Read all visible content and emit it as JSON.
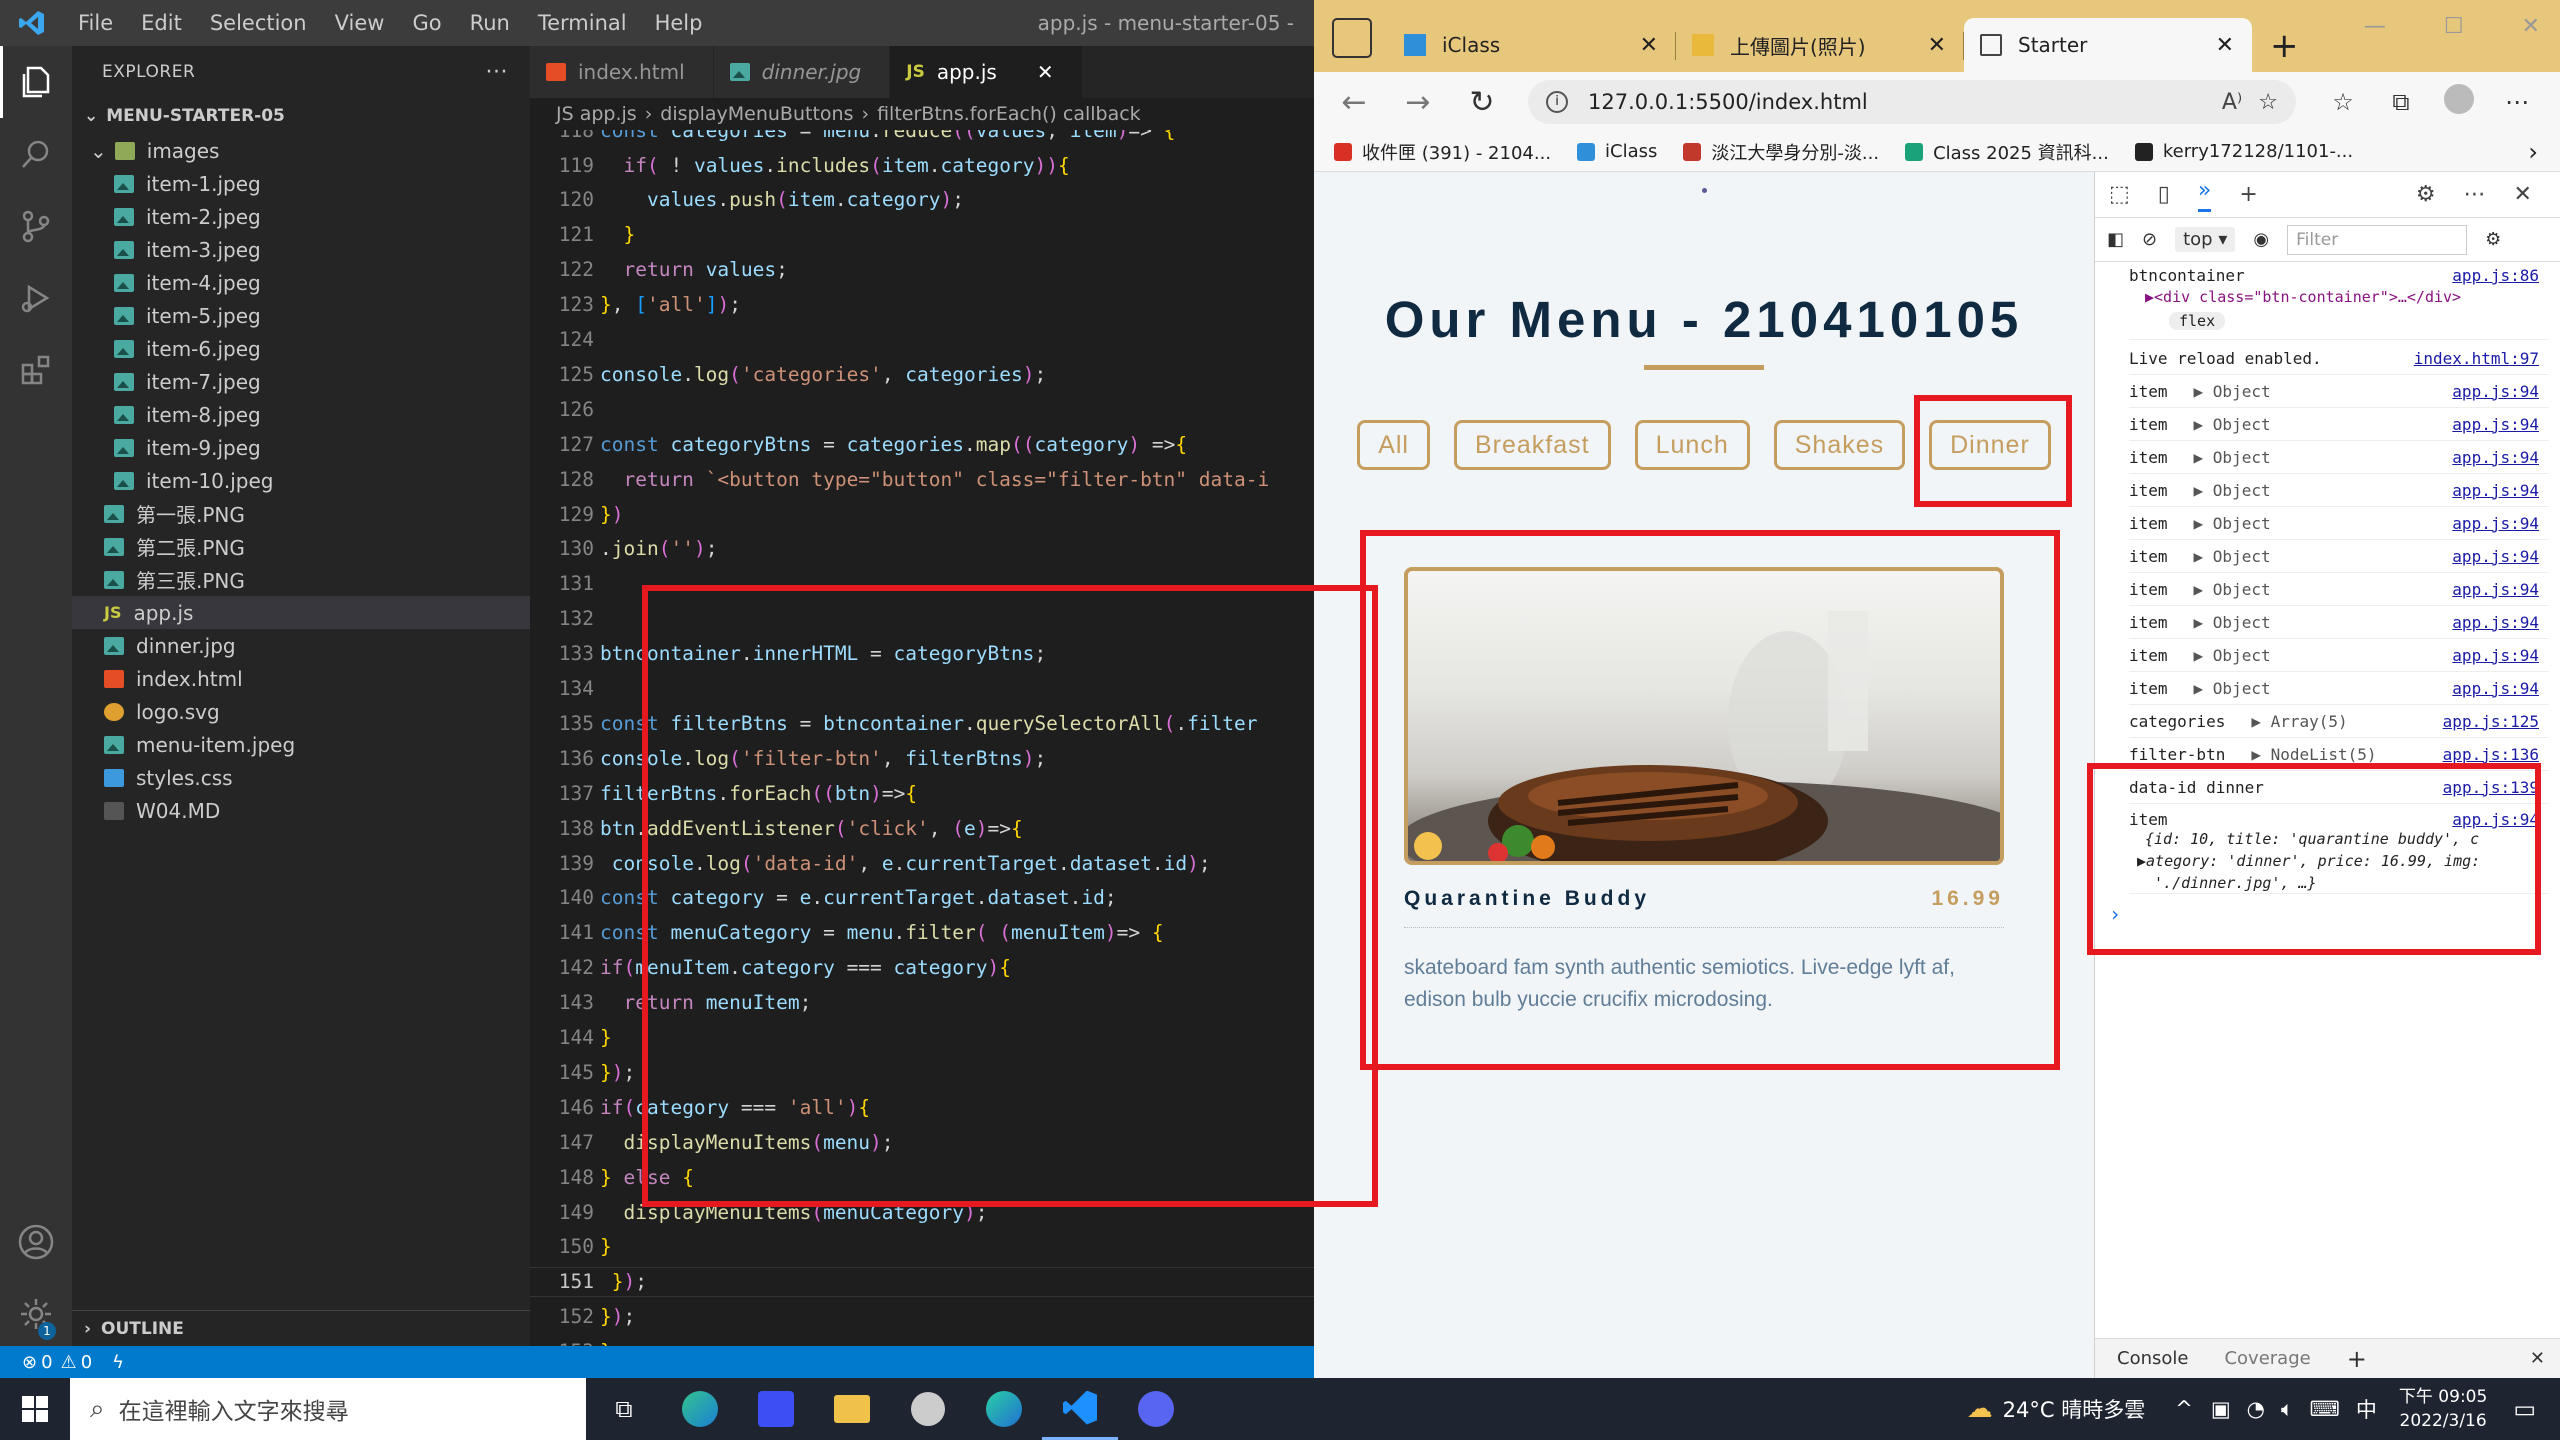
{
  "vscode": {
    "menu": [
      "File",
      "Edit",
      "Selection",
      "View",
      "Go",
      "Run",
      "Terminal",
      "Help"
    ],
    "window_title": "app.js - menu-starter-05 -",
    "explorer_label": "EXPLORER",
    "project": "MENU-STARTER-05",
    "tree": [
      {
        "name": "images",
        "type": "folder",
        "depth": 1
      },
      {
        "name": "item-1.jpeg",
        "type": "img",
        "depth": 2
      },
      {
        "name": "item-2.jpeg",
        "type": "img",
        "depth": 2
      },
      {
        "name": "item-3.jpeg",
        "type": "img",
        "depth": 2
      },
      {
        "name": "item-4.jpeg",
        "type": "img",
        "depth": 2
      },
      {
        "name": "item-5.jpeg",
        "type": "img",
        "depth": 2
      },
      {
        "name": "item-6.jpeg",
        "type": "img",
        "depth": 2
      },
      {
        "name": "item-7.jpeg",
        "type": "img",
        "depth": 2
      },
      {
        "name": "item-8.jpeg",
        "type": "img",
        "depth": 2
      },
      {
        "name": "item-9.jpeg",
        "type": "img",
        "depth": 2
      },
      {
        "name": "item-10.jpeg",
        "type": "img",
        "depth": 2
      },
      {
        "name": "第一張.PNG",
        "type": "img",
        "depth": 1
      },
      {
        "name": "第二張.PNG",
        "type": "img",
        "depth": 1
      },
      {
        "name": "第三張.PNG",
        "type": "img",
        "depth": 1
      },
      {
        "name": "app.js",
        "type": "js",
        "depth": 1,
        "selected": true
      },
      {
        "name": "dinner.jpg",
        "type": "img",
        "depth": 1
      },
      {
        "name": "index.html",
        "type": "html",
        "depth": 1
      },
      {
        "name": "logo.svg",
        "type": "svg",
        "depth": 1
      },
      {
        "name": "menu-item.jpeg",
        "type": "img",
        "depth": 1
      },
      {
        "name": "styles.css",
        "type": "css",
        "depth": 1
      },
      {
        "name": "W04.MD",
        "type": "md",
        "depth": 1
      }
    ],
    "outline_label": "OUTLINE",
    "tabs": [
      {
        "label": "index.html",
        "icon": "html"
      },
      {
        "label": "dinner.jpg",
        "icon": "img"
      },
      {
        "label": "app.js",
        "icon": "js",
        "active": true
      }
    ],
    "breadcrumb": [
      "JS app.js",
      "›",
      "displayMenuButtons",
      "›",
      "filterBtns.forEach() callback"
    ],
    "code": [
      {
        "n": "118",
        "t": "const categories = menu.reduce((values, item)=> {"
      },
      {
        "n": "119",
        "t": "  if( ! values.includes(item.category)){"
      },
      {
        "n": "120",
        "t": "    values.push(item.category);"
      },
      {
        "n": "121",
        "t": "  }"
      },
      {
        "n": "122",
        "t": "  return values;"
      },
      {
        "n": "123",
        "t": "}, ['all']);"
      },
      {
        "n": "124",
        "t": ""
      },
      {
        "n": "125",
        "t": "console.log('categories', categories);"
      },
      {
        "n": "126",
        "t": ""
      },
      {
        "n": "127",
        "t": "const categoryBtns = categories.map((category) =>{"
      },
      {
        "n": "128",
        "t": "  return `<button type=\"button\" class=\"filter-btn\" data-i"
      },
      {
        "n": "129",
        "t": "})"
      },
      {
        "n": "130",
        "t": ".join('');"
      },
      {
        "n": "131",
        "t": ""
      },
      {
        "n": "132",
        "t": ""
      },
      {
        "n": "133",
        "t": "btncontainer.innerHTML = categoryBtns;"
      },
      {
        "n": "134",
        "t": ""
      },
      {
        "n": "135",
        "t": "const filterBtns = btncontainer.querySelectorAll('.filter"
      },
      {
        "n": "136",
        "t": "console.log('filter-btn', filterBtns);"
      },
      {
        "n": "137",
        "t": "filterBtns.forEach((btn)=>{"
      },
      {
        "n": "138",
        "t": "btn.addEventListener('click', (e)=>{"
      },
      {
        "n": "139",
        "t": " console.log('data-id', e.currentTarget.dataset.id);"
      },
      {
        "n": "140",
        "t": "const category = e.currentTarget.dataset.id;"
      },
      {
        "n": "141",
        "t": "const menuCategory = menu.filter( (menuItem)=> {"
      },
      {
        "n": "142",
        "t": "if(menuItem.category === category){"
      },
      {
        "n": "143",
        "t": "  return menuItem;"
      },
      {
        "n": "144",
        "t": "}"
      },
      {
        "n": "145",
        "t": "});"
      },
      {
        "n": "146",
        "t": "if(category === 'all'){"
      },
      {
        "n": "147",
        "t": "  displayMenuItems(menu);"
      },
      {
        "n": "148",
        "t": "} else {"
      },
      {
        "n": "149",
        "t": "  displayMenuItems(menuCategory);"
      },
      {
        "n": "150",
        "t": "}"
      },
      {
        "n": "151",
        "t": " });"
      },
      {
        "n": "152",
        "t": "});"
      },
      {
        "n": "153",
        "t": "}"
      }
    ],
    "status": {
      "errors": "0",
      "warnings": "0"
    }
  },
  "browser": {
    "tabs": [
      {
        "label": "iClass"
      },
      {
        "label": "上傳圖片(照片)"
      },
      {
        "label": "Starter",
        "active": true
      }
    ],
    "url": "127.0.0.1:5500/index.html",
    "favorites": [
      "收件匣 (391) - 2104...",
      "iClass",
      "淡江大學身分別-淡...",
      "Class 2025 資訊科...",
      "kerry172128/1101-..."
    ],
    "page": {
      "title": "Our Menu - 210410105",
      "filters": [
        "All",
        "Breakfast",
        "Lunch",
        "Shakes",
        "Dinner"
      ],
      "item": {
        "name": "Quarantine Buddy",
        "price": "16.99",
        "desc": "skateboard fam synth authentic semiotics. Live-edge lyft af, edison bulb yuccie crucifix microdosing."
      }
    },
    "devtools": {
      "context": "top",
      "filter_placeholder": "Filter",
      "logs": [
        {
          "label": "btncontainer",
          "src": "app.js:86"
        },
        {
          "label": "Live reload enabled.",
          "src": "index.html:97"
        },
        {
          "label": "item",
          "obj": "▶ Object",
          "src": "app.js:94"
        },
        {
          "label": "item",
          "obj": "▶ Object",
          "src": "app.js:94"
        },
        {
          "label": "item",
          "obj": "▶ Object",
          "src": "app.js:94"
        },
        {
          "label": "item",
          "obj": "▶ Object",
          "src": "app.js:94"
        },
        {
          "label": "item",
          "obj": "▶ Object",
          "src": "app.js:94"
        },
        {
          "label": "item",
          "obj": "▶ Object",
          "src": "app.js:94"
        },
        {
          "label": "item",
          "obj": "▶ Object",
          "src": "app.js:94"
        },
        {
          "label": "item",
          "obj": "▶ Object",
          "src": "app.js:94"
        },
        {
          "label": "item",
          "obj": "▶ Object",
          "src": "app.js:94"
        },
        {
          "label": "item",
          "obj": "▶ Object",
          "src": "app.js:94"
        },
        {
          "label": "categories",
          "obj": "▶ Array(5)",
          "src": "app.js:125"
        },
        {
          "label": "filter-btn",
          "obj": "▶ NodeList(5)",
          "src": "app.js:136"
        },
        {
          "label": "data-id dinner",
          "src": "app.js:139"
        },
        {
          "label": "item",
          "src": "app.js:94"
        }
      ],
      "btncontainer_node": "▶<div class=\"btn-container\">…</div>",
      "flex_badge": "flex",
      "item_detail": [
        "{id: 10, title: 'quarantine buddy', c",
        "▶ategory: 'dinner', price: 16.99, img:",
        " './dinner.jpg', …}"
      ],
      "bottom_tabs": [
        "Console",
        "Coverage"
      ]
    }
  },
  "taskbar": {
    "search_placeholder": "在這裡輸入文字來搜尋",
    "weather": "24°C  晴時多雲",
    "ime": "中",
    "time": "下午 09:05",
    "date": "2022/3/16"
  }
}
